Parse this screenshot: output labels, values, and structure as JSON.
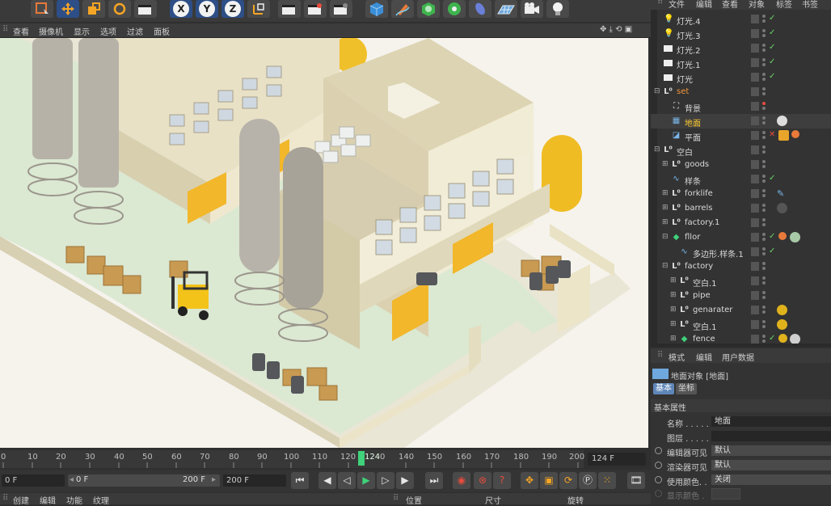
{
  "toolbar": {
    "axis_x": "X",
    "axis_y": "Y",
    "axis_z": "Z"
  },
  "view_menu": [
    "查看",
    "摄像机",
    "显示",
    "选项",
    "过滤",
    "面板"
  ],
  "timeline": {
    "ticks": [
      "0",
      "10",
      "20",
      "30",
      "40",
      "50",
      "60",
      "70",
      "80",
      "90",
      "100",
      "110",
      "120",
      "124",
      "0",
      "140",
      "150",
      "160",
      "170",
      "180",
      "190",
      "200"
    ],
    "current_frame": "124 F"
  },
  "transport": {
    "start": "0 F",
    "range_start": "0 F",
    "range_end": "200 F",
    "end": "200 F"
  },
  "bottom_menu": {
    "left": [
      "创建",
      "编辑",
      "功能",
      "纹理"
    ],
    "coords": [
      "位置",
      "尺寸",
      "旋转"
    ]
  },
  "object_menu": [
    "文件",
    "编辑",
    "查看",
    "对象",
    "标签",
    "书签"
  ],
  "objects": [
    {
      "label": "灯光.4",
      "icon": "light-icon",
      "indent": 0,
      "style": "normal"
    },
    {
      "label": "灯光.3",
      "icon": "light-icon",
      "indent": 0,
      "style": "normal"
    },
    {
      "label": "灯光.2",
      "icon": "light-icon",
      "indent": 0,
      "style": "normal"
    },
    {
      "label": "灯光.1",
      "icon": "light-icon",
      "indent": 0,
      "style": "normal"
    },
    {
      "label": "灯光",
      "icon": "light-icon",
      "indent": 0,
      "style": "normal"
    },
    {
      "label": "set",
      "icon": "null-icon",
      "indent": 0,
      "style": "orange"
    },
    {
      "label": "背景",
      "icon": "background-icon",
      "indent": 1,
      "style": "normal"
    },
    {
      "label": "地面",
      "icon": "floor-icon",
      "indent": 1,
      "style": "selected"
    },
    {
      "label": "平面",
      "icon": "plane-icon",
      "indent": 1,
      "style": "normal"
    },
    {
      "label": "空白",
      "icon": "null-icon",
      "indent": 0,
      "style": "normal"
    },
    {
      "label": "goods",
      "icon": "null-icon",
      "indent": 1,
      "style": "normal"
    },
    {
      "label": "样条",
      "icon": "spline-icon",
      "indent": 1,
      "style": "normal"
    },
    {
      "label": "forklife",
      "icon": "null-icon",
      "indent": 1,
      "style": "normal"
    },
    {
      "label": "barrels",
      "icon": "null-icon",
      "indent": 1,
      "style": "normal"
    },
    {
      "label": "factory.1",
      "icon": "null-icon",
      "indent": 1,
      "style": "normal"
    },
    {
      "label": "fllor",
      "icon": "extrude-icon",
      "indent": 1,
      "style": "normal"
    },
    {
      "label": "多边形.样条.1",
      "icon": "spline-icon",
      "indent": 2,
      "style": "normal"
    },
    {
      "label": "factory",
      "icon": "null-icon",
      "indent": 1,
      "style": "normal"
    },
    {
      "label": "空白.1",
      "icon": "null-icon",
      "indent": 2,
      "style": "normal"
    },
    {
      "label": "pipe",
      "icon": "null-icon",
      "indent": 2,
      "style": "normal"
    },
    {
      "label": "genarater",
      "icon": "null-icon",
      "indent": 2,
      "style": "normal"
    },
    {
      "label": "空白.1",
      "icon": "null-icon",
      "indent": 2,
      "style": "normal"
    },
    {
      "label": "fence",
      "icon": "extrude-icon",
      "indent": 2,
      "style": "normal"
    }
  ],
  "attr_menu": [
    "模式",
    "编辑",
    "用户数据"
  ],
  "attributes": {
    "header": "地面对象 [地面]",
    "tabs": [
      "基本",
      "坐标"
    ],
    "section": "基本属性",
    "name_label": "名称 . . . . .",
    "name_value": "地面",
    "layer_label": "图层 . . . . .",
    "layer_value": "",
    "editor_visible_label": "编辑器可见",
    "editor_visible_value": "默认",
    "render_visible_label": "渲染器可见",
    "render_visible_value": "默认",
    "use_color_label": "使用颜色. .",
    "use_color_value": "关闭",
    "display_color_label": "显示颜色 ."
  }
}
